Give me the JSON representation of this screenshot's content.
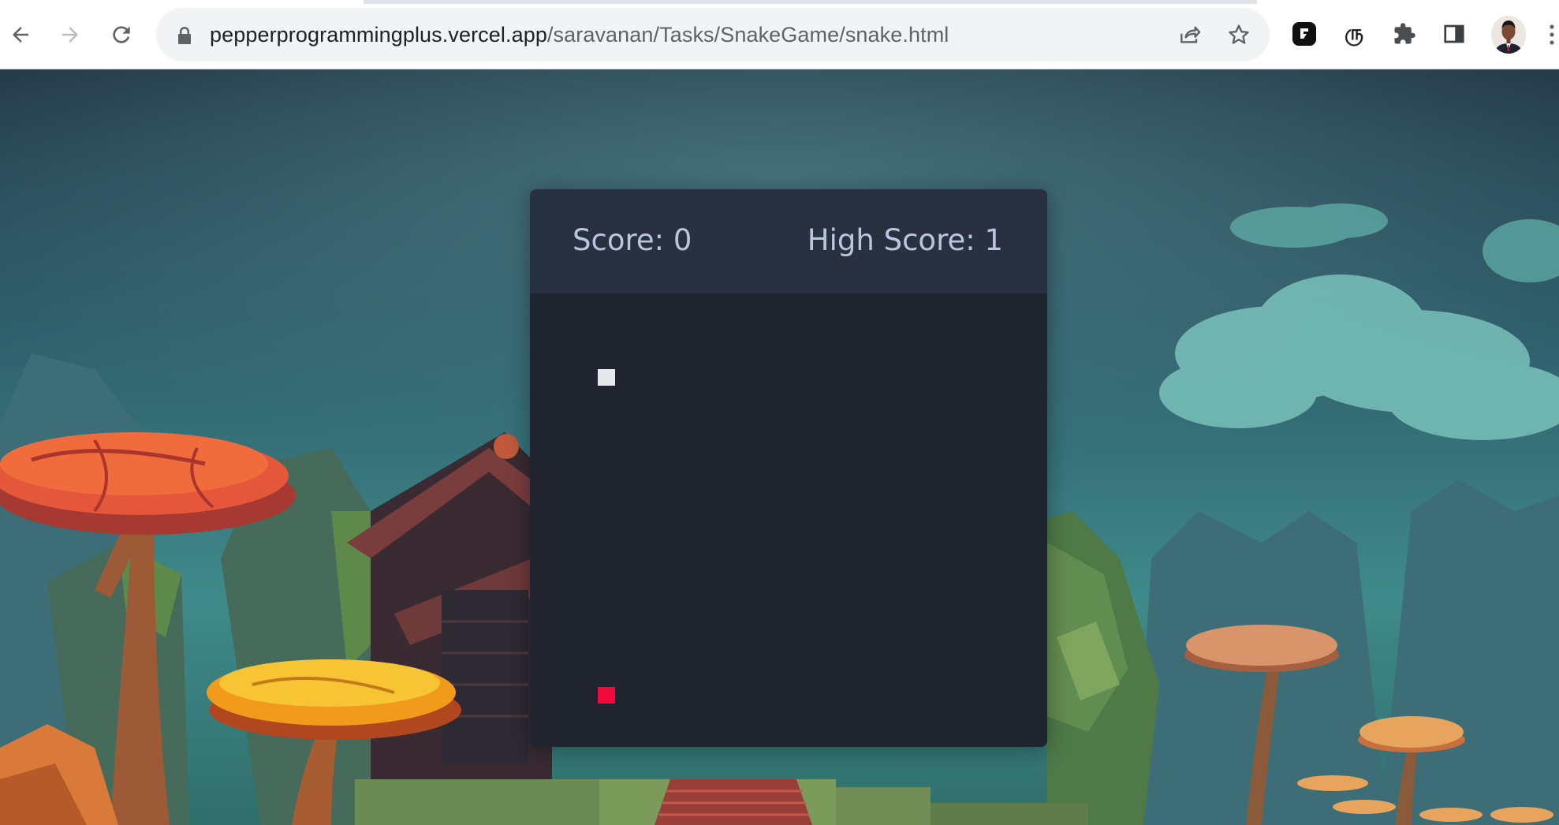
{
  "browser": {
    "url_host": "pepperprogrammingplus.vercel.app",
    "url_path": "/saravanan/Tasks/SnakeGame/snake.html",
    "nav_icons": [
      "back-arrow-icon",
      "forward-arrow-icon",
      "reload-icon"
    ],
    "omnibox_icons": [
      "lock-icon",
      "share-icon",
      "star-icon"
    ],
    "extension_icons": [
      "r-extension-icon",
      "tamil-extension-icon",
      "puzzle-icon",
      "side-panel-icon"
    ],
    "ext_tamil_glyph": "ரு"
  },
  "game": {
    "score_label": "Score: 0",
    "high_score_label": "High Score: 1",
    "snake_color": "#e6e8ee",
    "food_color": "#f0093a"
  },
  "colors": {
    "card_bg": "#20242f",
    "card_header_bg": "#293040",
    "score_text": "#b8c6de"
  }
}
